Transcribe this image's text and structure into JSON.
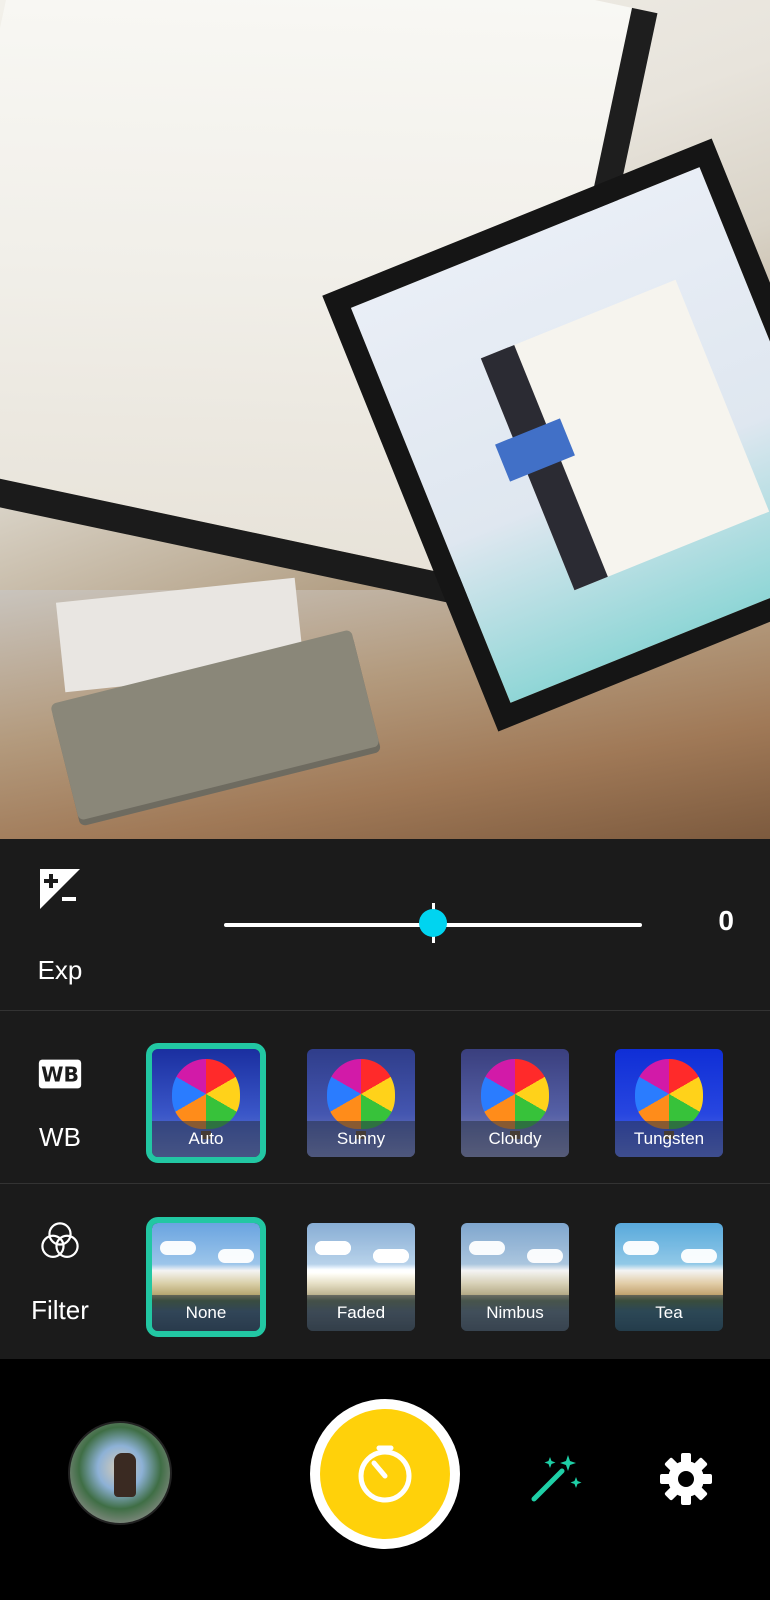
{
  "exposure": {
    "label": "Exp",
    "value": "0",
    "slider_fraction": 0.5
  },
  "white_balance": {
    "label": "WB",
    "icon_text": "WB",
    "options": [
      "Auto",
      "Sunny",
      "Cloudy",
      "Tungsten"
    ],
    "selected": "Auto"
  },
  "filter": {
    "label": "Filter",
    "options": [
      "None",
      "Faded",
      "Nimbus",
      "Tea"
    ],
    "selected": "None"
  },
  "colors": {
    "accent_selection": "#22c7a3",
    "slider_knob": "#00d4f0",
    "shutter": "#ffd10a",
    "panel_bg": "#1b1b1b"
  },
  "icons": {
    "exposure": "exposure-plus-minus-icon",
    "wb": "wb-icon",
    "filter": "filter-circles-icon",
    "shutter": "timer-icon",
    "magic": "magic-wand-icon",
    "settings": "gear-icon"
  }
}
